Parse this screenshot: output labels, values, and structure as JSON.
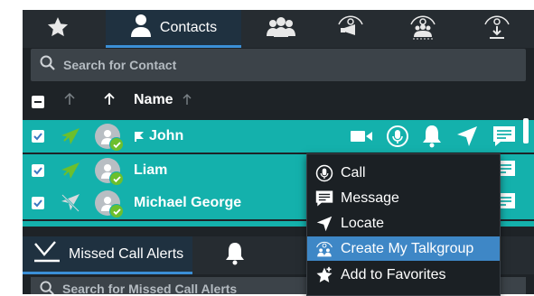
{
  "tabs": [
    {
      "name": "favorites-tab",
      "icon": "star-icon",
      "label": ""
    },
    {
      "name": "contacts-tab",
      "icon": "person-icon",
      "label": "Contacts"
    },
    {
      "name": "groups-tab",
      "icon": "group-icon",
      "label": ""
    },
    {
      "name": "broadcast-tab",
      "icon": "broadcast-icon",
      "label": ""
    },
    {
      "name": "group-broadcast-tab",
      "icon": "group-broadcast-icon",
      "label": ""
    },
    {
      "name": "download-tab",
      "icon": "download-person-icon",
      "label": ""
    }
  ],
  "search": {
    "placeholder": "Search for Contact"
  },
  "header": {
    "name_label": "Name"
  },
  "contacts": [
    {
      "name": "John",
      "checked": true,
      "location_status": "active",
      "flagged": true
    },
    {
      "name": "Liam",
      "checked": true,
      "location_status": "active",
      "flagged": false
    },
    {
      "name": "Michael George",
      "checked": true,
      "location_status": "disabled",
      "flagged": false
    }
  ],
  "row_actions": [
    "video-icon",
    "ptt-icon",
    "alert-bell-icon",
    "locate-icon",
    "message-icon"
  ],
  "context_menu": {
    "items": [
      {
        "label": "Call",
        "icon": "ptt-icon",
        "highlighted": false
      },
      {
        "label": "Message",
        "icon": "message-icon",
        "highlighted": false
      },
      {
        "label": "Locate",
        "icon": "locate-icon",
        "highlighted": false
      },
      {
        "label": "Create My Talkgroup",
        "icon": "talkgroup-icon",
        "highlighted": true
      },
      {
        "label": "Add to Favorites",
        "icon": "star-plus-icon",
        "highlighted": false
      }
    ]
  },
  "bottom": {
    "tab_label": "Missed Call Alerts",
    "search_placeholder": "Search for Missed Call Alerts"
  },
  "colors": {
    "row_bg": "#14b1ac",
    "menu_highlight": "#3e87c6",
    "accent": "#3b8fd6",
    "status_green": "#6cbf2d"
  }
}
